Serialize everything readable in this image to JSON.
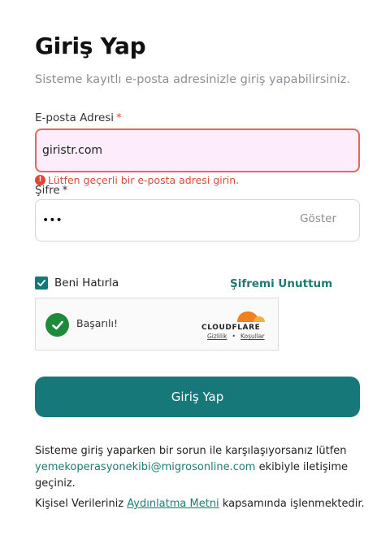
{
  "header": {
    "title": "Giriş Yap",
    "subtitle": "Sisteme kayıtlı e-posta adresinizle giriş yapabilirsiniz."
  },
  "email": {
    "label": "E-posta Adresi",
    "required_mark": "*",
    "value": "giristr.com",
    "error": "Lütfen geçerli bir e-posta adresi girin."
  },
  "password": {
    "label": "Şifre",
    "required_mark": "*",
    "value": "•••",
    "show_label": "Göster"
  },
  "remember": {
    "label": "Beni Hatırla",
    "checked": true
  },
  "forgot_label": "Şifremi Unuttum",
  "captcha": {
    "status": "Başarılı!",
    "brand": "CLOUDFLARE",
    "privacy": "Gizlilik",
    "separator": "•",
    "terms": "Koşullar"
  },
  "submit_label": "Giriş Yap",
  "help": {
    "prefix": "Sisteme giriş yaparken bir sorun ile karşılaşıyorsanız lütfen",
    "email": "yemekoperasyonekibi@migrosonline.com",
    "suffix": "ekibiyle iletişime geçiniz."
  },
  "kvkk": {
    "prefix": "Kişisel Verileriniz",
    "link": "Aydınlatma Metni",
    "suffix": "kapsamında işlenmektedir."
  },
  "colors": {
    "primary": "#167878",
    "link": "#1f7a74",
    "error": "#e0463a",
    "error_field_bg": "#fdecfb",
    "success": "#1f8a3b"
  }
}
